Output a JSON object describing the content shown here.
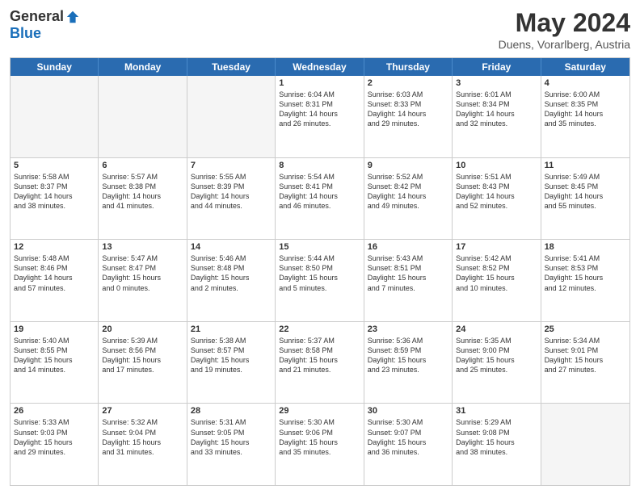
{
  "logo": {
    "general": "General",
    "blue": "Blue"
  },
  "title": "May 2024",
  "location": "Duens, Vorarlberg, Austria",
  "days_of_week": [
    "Sunday",
    "Monday",
    "Tuesday",
    "Wednesday",
    "Thursday",
    "Friday",
    "Saturday"
  ],
  "weeks": [
    [
      {
        "day": "",
        "info": [],
        "empty": true
      },
      {
        "day": "",
        "info": [],
        "empty": true
      },
      {
        "day": "",
        "info": [],
        "empty": true
      },
      {
        "day": "1",
        "info": [
          "Sunrise: 6:04 AM",
          "Sunset: 8:31 PM",
          "Daylight: 14 hours",
          "and 26 minutes."
        ],
        "empty": false
      },
      {
        "day": "2",
        "info": [
          "Sunrise: 6:03 AM",
          "Sunset: 8:33 PM",
          "Daylight: 14 hours",
          "and 29 minutes."
        ],
        "empty": false
      },
      {
        "day": "3",
        "info": [
          "Sunrise: 6:01 AM",
          "Sunset: 8:34 PM",
          "Daylight: 14 hours",
          "and 32 minutes."
        ],
        "empty": false
      },
      {
        "day": "4",
        "info": [
          "Sunrise: 6:00 AM",
          "Sunset: 8:35 PM",
          "Daylight: 14 hours",
          "and 35 minutes."
        ],
        "empty": false
      }
    ],
    [
      {
        "day": "5",
        "info": [
          "Sunrise: 5:58 AM",
          "Sunset: 8:37 PM",
          "Daylight: 14 hours",
          "and 38 minutes."
        ],
        "empty": false
      },
      {
        "day": "6",
        "info": [
          "Sunrise: 5:57 AM",
          "Sunset: 8:38 PM",
          "Daylight: 14 hours",
          "and 41 minutes."
        ],
        "empty": false
      },
      {
        "day": "7",
        "info": [
          "Sunrise: 5:55 AM",
          "Sunset: 8:39 PM",
          "Daylight: 14 hours",
          "and 44 minutes."
        ],
        "empty": false
      },
      {
        "day": "8",
        "info": [
          "Sunrise: 5:54 AM",
          "Sunset: 8:41 PM",
          "Daylight: 14 hours",
          "and 46 minutes."
        ],
        "empty": false
      },
      {
        "day": "9",
        "info": [
          "Sunrise: 5:52 AM",
          "Sunset: 8:42 PM",
          "Daylight: 14 hours",
          "and 49 minutes."
        ],
        "empty": false
      },
      {
        "day": "10",
        "info": [
          "Sunrise: 5:51 AM",
          "Sunset: 8:43 PM",
          "Daylight: 14 hours",
          "and 52 minutes."
        ],
        "empty": false
      },
      {
        "day": "11",
        "info": [
          "Sunrise: 5:49 AM",
          "Sunset: 8:45 PM",
          "Daylight: 14 hours",
          "and 55 minutes."
        ],
        "empty": false
      }
    ],
    [
      {
        "day": "12",
        "info": [
          "Sunrise: 5:48 AM",
          "Sunset: 8:46 PM",
          "Daylight: 14 hours",
          "and 57 minutes."
        ],
        "empty": false
      },
      {
        "day": "13",
        "info": [
          "Sunrise: 5:47 AM",
          "Sunset: 8:47 PM",
          "Daylight: 15 hours",
          "and 0 minutes."
        ],
        "empty": false
      },
      {
        "day": "14",
        "info": [
          "Sunrise: 5:46 AM",
          "Sunset: 8:48 PM",
          "Daylight: 15 hours",
          "and 2 minutes."
        ],
        "empty": false
      },
      {
        "day": "15",
        "info": [
          "Sunrise: 5:44 AM",
          "Sunset: 8:50 PM",
          "Daylight: 15 hours",
          "and 5 minutes."
        ],
        "empty": false
      },
      {
        "day": "16",
        "info": [
          "Sunrise: 5:43 AM",
          "Sunset: 8:51 PM",
          "Daylight: 15 hours",
          "and 7 minutes."
        ],
        "empty": false
      },
      {
        "day": "17",
        "info": [
          "Sunrise: 5:42 AM",
          "Sunset: 8:52 PM",
          "Daylight: 15 hours",
          "and 10 minutes."
        ],
        "empty": false
      },
      {
        "day": "18",
        "info": [
          "Sunrise: 5:41 AM",
          "Sunset: 8:53 PM",
          "Daylight: 15 hours",
          "and 12 minutes."
        ],
        "empty": false
      }
    ],
    [
      {
        "day": "19",
        "info": [
          "Sunrise: 5:40 AM",
          "Sunset: 8:55 PM",
          "Daylight: 15 hours",
          "and 14 minutes."
        ],
        "empty": false
      },
      {
        "day": "20",
        "info": [
          "Sunrise: 5:39 AM",
          "Sunset: 8:56 PM",
          "Daylight: 15 hours",
          "and 17 minutes."
        ],
        "empty": false
      },
      {
        "day": "21",
        "info": [
          "Sunrise: 5:38 AM",
          "Sunset: 8:57 PM",
          "Daylight: 15 hours",
          "and 19 minutes."
        ],
        "empty": false
      },
      {
        "day": "22",
        "info": [
          "Sunrise: 5:37 AM",
          "Sunset: 8:58 PM",
          "Daylight: 15 hours",
          "and 21 minutes."
        ],
        "empty": false
      },
      {
        "day": "23",
        "info": [
          "Sunrise: 5:36 AM",
          "Sunset: 8:59 PM",
          "Daylight: 15 hours",
          "and 23 minutes."
        ],
        "empty": false
      },
      {
        "day": "24",
        "info": [
          "Sunrise: 5:35 AM",
          "Sunset: 9:00 PM",
          "Daylight: 15 hours",
          "and 25 minutes."
        ],
        "empty": false
      },
      {
        "day": "25",
        "info": [
          "Sunrise: 5:34 AM",
          "Sunset: 9:01 PM",
          "Daylight: 15 hours",
          "and 27 minutes."
        ],
        "empty": false
      }
    ],
    [
      {
        "day": "26",
        "info": [
          "Sunrise: 5:33 AM",
          "Sunset: 9:03 PM",
          "Daylight: 15 hours",
          "and 29 minutes."
        ],
        "empty": false
      },
      {
        "day": "27",
        "info": [
          "Sunrise: 5:32 AM",
          "Sunset: 9:04 PM",
          "Daylight: 15 hours",
          "and 31 minutes."
        ],
        "empty": false
      },
      {
        "day": "28",
        "info": [
          "Sunrise: 5:31 AM",
          "Sunset: 9:05 PM",
          "Daylight: 15 hours",
          "and 33 minutes."
        ],
        "empty": false
      },
      {
        "day": "29",
        "info": [
          "Sunrise: 5:30 AM",
          "Sunset: 9:06 PM",
          "Daylight: 15 hours",
          "and 35 minutes."
        ],
        "empty": false
      },
      {
        "day": "30",
        "info": [
          "Sunrise: 5:30 AM",
          "Sunset: 9:07 PM",
          "Daylight: 15 hours",
          "and 36 minutes."
        ],
        "empty": false
      },
      {
        "day": "31",
        "info": [
          "Sunrise: 5:29 AM",
          "Sunset: 9:08 PM",
          "Daylight: 15 hours",
          "and 38 minutes."
        ],
        "empty": false
      },
      {
        "day": "",
        "info": [],
        "empty": true
      }
    ]
  ]
}
